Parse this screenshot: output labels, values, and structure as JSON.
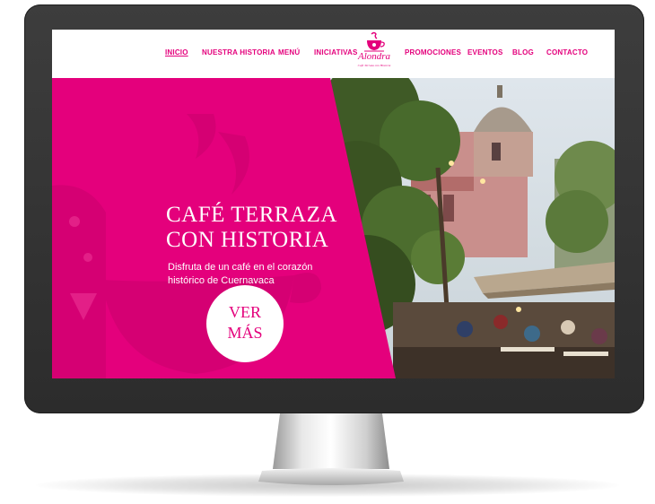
{
  "nav": {
    "items_left": [
      "INICIO",
      "NUESTRA HISTORIA",
      "MENÚ",
      "INICIATIVAS"
    ],
    "items_right": [
      "PROMOCIONES",
      "EVENTOS",
      "BLOG",
      "CONTACTO"
    ],
    "active": "INICIO"
  },
  "logo": {
    "name": "Alondra",
    "tagline": "Café Terraza con Historia"
  },
  "hero": {
    "title_line1": "CAFÉ TERRAZA",
    "title_line2": "CON HISTORIA",
    "subtitle_line1": "Disfruta de un café en el corazón",
    "subtitle_line2": "histórico de Cuernavaca",
    "cta_line1": "VER",
    "cta_line2": "MÁS"
  },
  "colors": {
    "brand_pink": "#e4007c",
    "bezel": "#2f2f2f"
  }
}
